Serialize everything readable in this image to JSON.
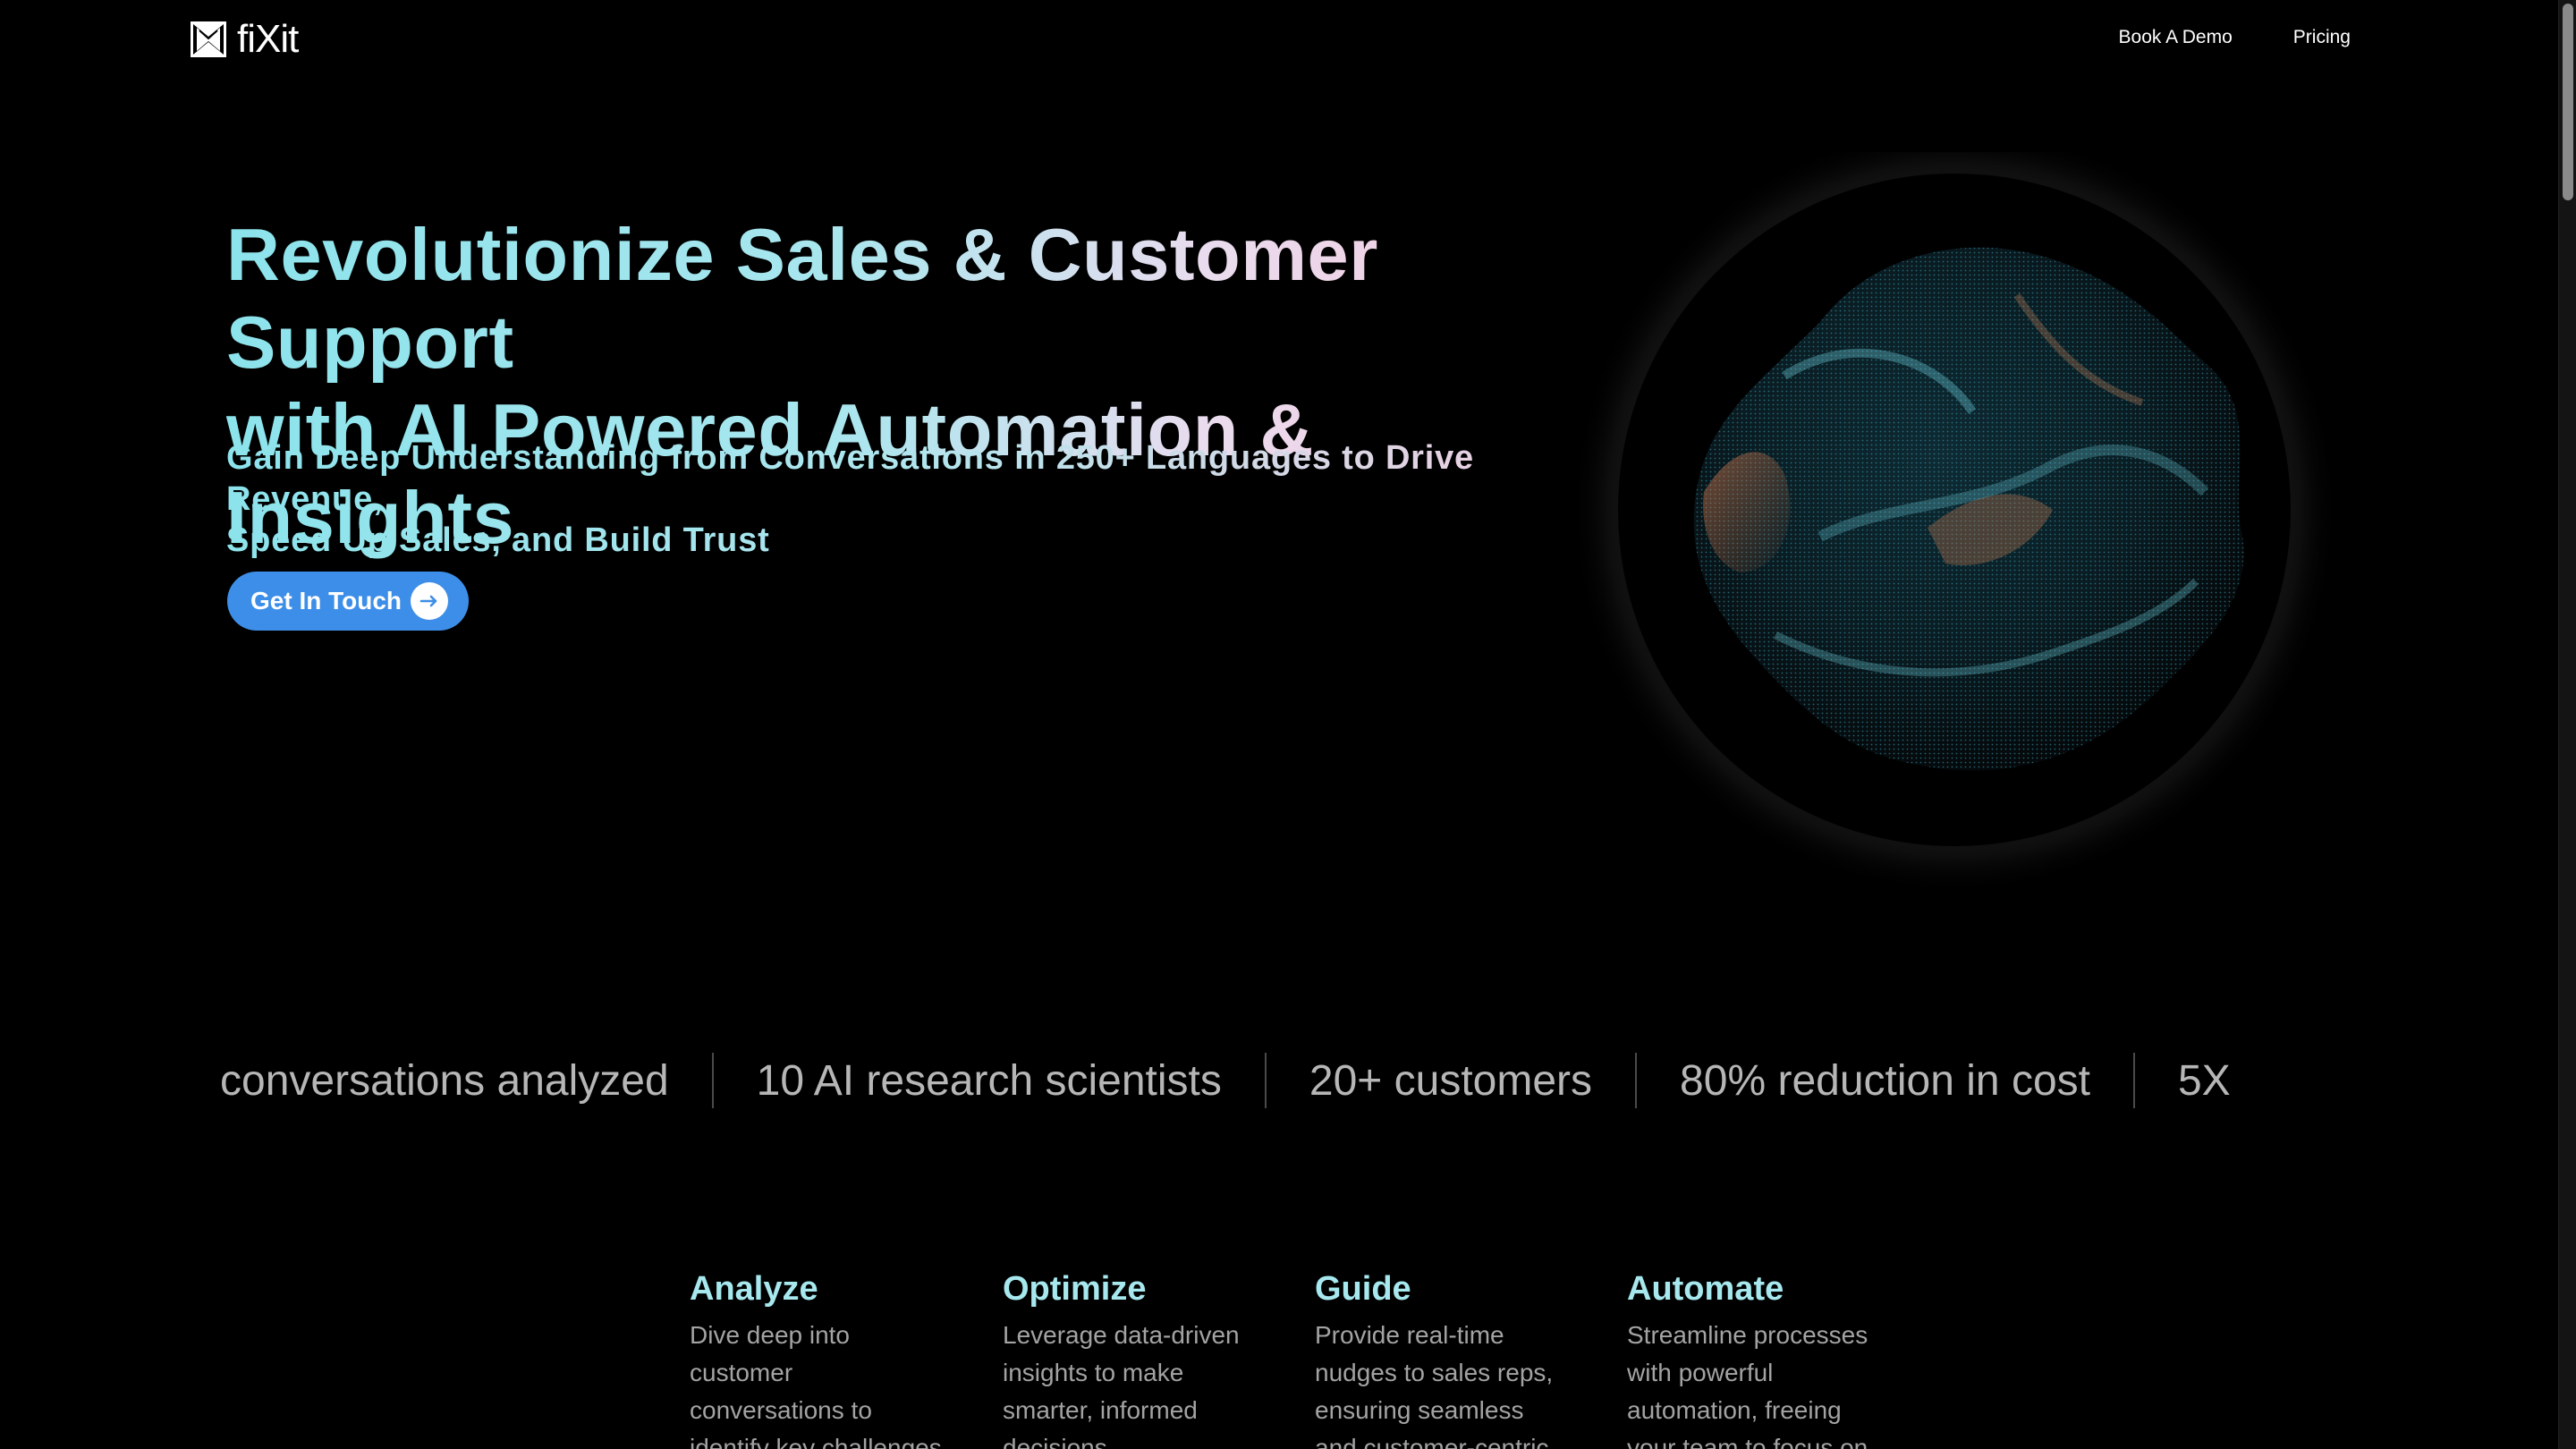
{
  "nav": {
    "brand": "fiXit",
    "links": [
      "Book A Demo",
      "Pricing"
    ]
  },
  "hero": {
    "title_line1": "Revolutionize Sales & Customer Support",
    "title_line2": "with AI Powered Automation & Insights",
    "subtitle_line1": "Gain Deep Understanding from Conversations in 250+ Languages to Drive Revenue,",
    "subtitle_line2": "Speed Up Sales, and Build Trust",
    "cta_label": "Get In Touch"
  },
  "stats": [
    "conversations analyzed",
    "10 AI research scientists",
    "20+ customers",
    "80% reduction in cost",
    "5X"
  ],
  "features": [
    {
      "title": "Analyze",
      "desc": "Dive deep into customer conversations to identify key challenges"
    },
    {
      "title": "Optimize",
      "desc": "Leverage data-driven insights to make smarter, informed decisions"
    },
    {
      "title": "Guide",
      "desc": "Provide real-time nudges to sales reps, ensuring seamless and customer-centric"
    },
    {
      "title": "Automate",
      "desc": "Streamline processes with powerful automation, freeing your team to focus on"
    }
  ],
  "colors": {
    "accent": "#3d8ee8",
    "title_teal": "#8ce3ec",
    "title_pink": "#f6c8dc",
    "stat_text": "#b6b6b6",
    "background": "#000000"
  }
}
